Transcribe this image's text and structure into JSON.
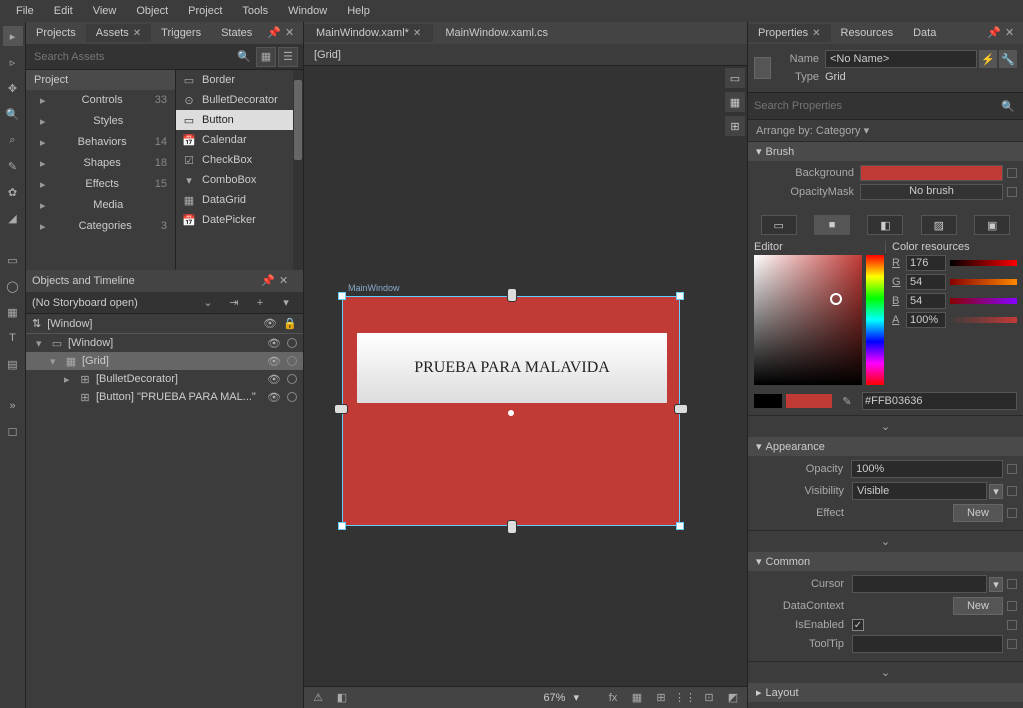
{
  "menu": [
    "File",
    "Edit",
    "View",
    "Object",
    "Project",
    "Tools",
    "Window",
    "Help"
  ],
  "left_tabs": [
    "Projects",
    "Assets",
    "Triggers",
    "States"
  ],
  "left_tabs_active": 1,
  "search_assets_placeholder": "Search Assets",
  "categories": [
    {
      "name": "Project",
      "count": ""
    },
    {
      "name": "Controls",
      "count": "33"
    },
    {
      "name": "Styles",
      "count": ""
    },
    {
      "name": "Behaviors",
      "count": "14"
    },
    {
      "name": "Shapes",
      "count": "18"
    },
    {
      "name": "Effects",
      "count": "15"
    },
    {
      "name": "Media",
      "count": ""
    },
    {
      "name": "Categories",
      "count": "3"
    }
  ],
  "controls": [
    "Border",
    "BulletDecorator",
    "Button",
    "Calendar",
    "CheckBox",
    "ComboBox",
    "DataGrid",
    "DatePicker"
  ],
  "controls_selected": 2,
  "objects_title": "Objects and Timeline",
  "no_storyboard": "(No Storyboard open)",
  "obj_root": "[Window]",
  "tree": [
    {
      "label": "[Window]",
      "depth": 0,
      "sel": false,
      "expanded": true
    },
    {
      "label": "[Grid]",
      "depth": 1,
      "sel": true,
      "expanded": true
    },
    {
      "label": "[BulletDecorator]",
      "depth": 2,
      "sel": false,
      "expanded": false
    },
    {
      "label": "[Button] \"PRUEBA PARA MAL...\"",
      "depth": 2,
      "sel": false,
      "leaf": true
    }
  ],
  "doc_tabs": [
    "MainWindow.xaml*",
    "MainWindow.xaml.cs"
  ],
  "doc_tabs_active": 0,
  "breadcrumb": "[Grid]",
  "artboard_label": "MainWindow",
  "button_text": "PRUEBA PARA MALAVIDA",
  "zoom": "67%",
  "right_tabs": [
    "Properties",
    "Resources",
    "Data"
  ],
  "right_tabs_active": 0,
  "prop_name_label": "Name",
  "prop_name_value": "<No Name>",
  "prop_type_label": "Type",
  "prop_type_value": "Grid",
  "search_props_placeholder": "Search Properties",
  "arrange_by": "Arrange by: Category ▾",
  "brush_section": "Brush",
  "brush_rows": [
    {
      "label": "Background",
      "color": "#c23a36"
    },
    {
      "label": "OpacityMask",
      "text": "No brush"
    }
  ],
  "editor_label": "Editor",
  "color_res_label": "Color resources",
  "rgba": {
    "R": "176",
    "G": "54",
    "B": "54",
    "A": "100%"
  },
  "hex": "#FFB03636",
  "appearance_section": "Appearance",
  "opacity_label": "Opacity",
  "opacity_value": "100%",
  "visibility_label": "Visibility",
  "visibility_value": "Visible",
  "effect_label": "Effect",
  "new_label": "New",
  "common_section": "Common",
  "cursor_label": "Cursor",
  "datacontext_label": "DataContext",
  "isenabled_label": "IsEnabled",
  "tooltip_label": "ToolTip",
  "layout_section": "Layout"
}
